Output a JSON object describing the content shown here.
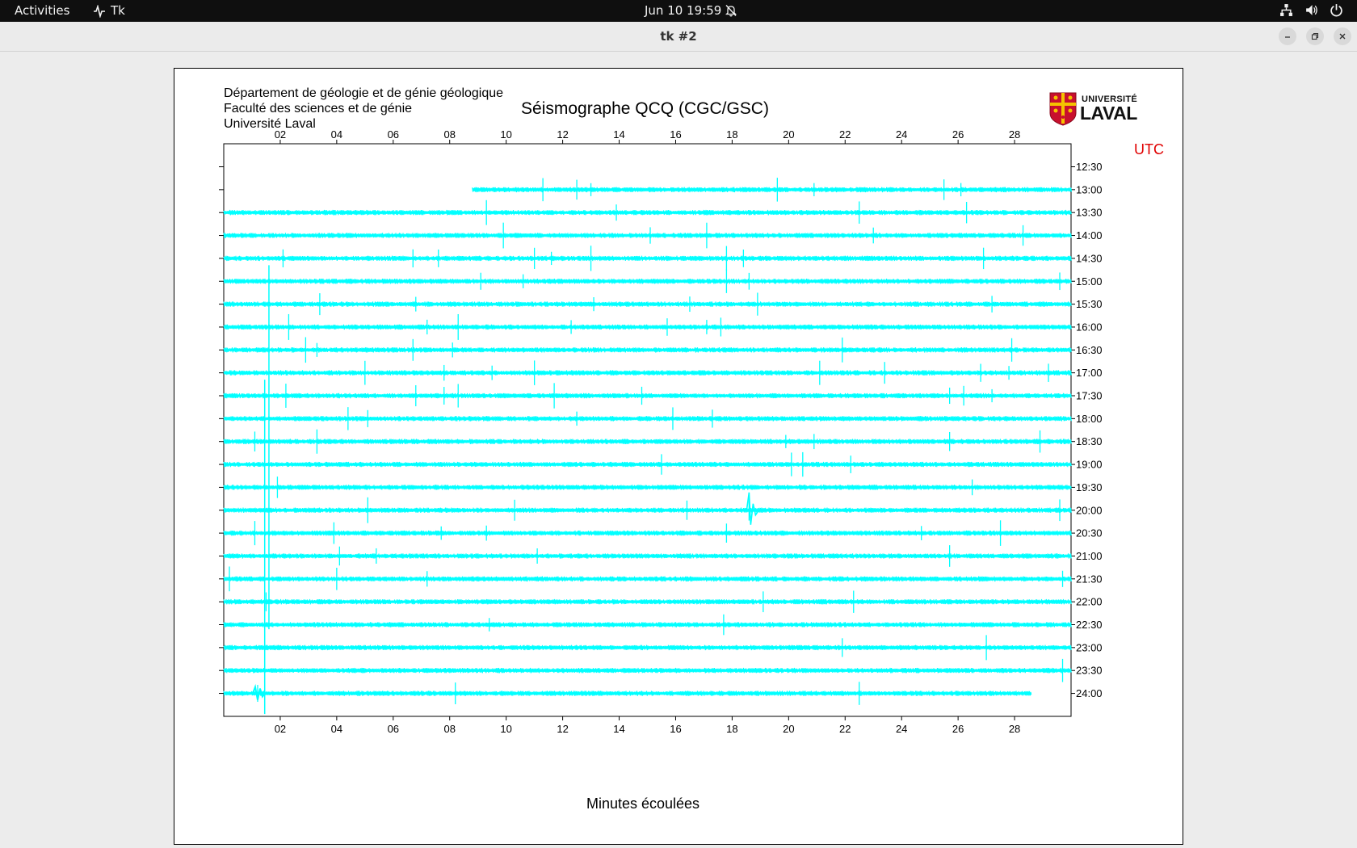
{
  "topbar": {
    "activities": "Activities",
    "app_name": "Tk",
    "clock": "Jun 10  19:59"
  },
  "window": {
    "title": "tk #2"
  },
  "seismogram": {
    "department_lines": [
      "Département de géologie et de génie géologique",
      "Faculté des sciences et de génie",
      "Université Laval"
    ],
    "title": "Séismographe QCQ (CGC/GSC)",
    "utc_label": "UTC",
    "xlabel": "Minutes écoulées",
    "logo_line1": "UNIVERSITÉ",
    "logo_line2": "LAVAL"
  },
  "chart_data": {
    "type": "line",
    "trace_color": "#00ffff",
    "x_unit": "minutes",
    "x_range": [
      0,
      30
    ],
    "x_ticks": [
      "02",
      "04",
      "06",
      "08",
      "10",
      "12",
      "14",
      "16",
      "18",
      "20",
      "22",
      "24",
      "26",
      "28"
    ],
    "y_ticks": [
      "12:30",
      "13:00",
      "13:30",
      "14:00",
      "14:30",
      "15:00",
      "15:30",
      "16:00",
      "16:30",
      "17:00",
      "17:30",
      "18:00",
      "18:30",
      "19:00",
      "19:30",
      "20:00",
      "20:30",
      "21:00",
      "21:30",
      "22:00",
      "22:30",
      "23:00",
      "23:30",
      "24:00"
    ],
    "traces": [
      {
        "label": "13:00",
        "start_min": 8.8,
        "end_min": 30,
        "spikes_min": [
          11.3,
          12.5,
          13.0,
          19.6,
          20.9,
          25.5,
          26.1
        ]
      },
      {
        "label": "13:30",
        "start_min": 0,
        "end_min": 30,
        "spikes_min": [
          9.3,
          13.9,
          22.5,
          26.3
        ]
      },
      {
        "label": "14:00",
        "start_min": 0,
        "end_min": 30,
        "spikes_min": [
          9.9,
          15.1,
          17.1,
          23.0,
          28.3
        ]
      },
      {
        "label": "14:30",
        "start_min": 0,
        "end_min": 30,
        "spikes_min": [
          2.1,
          6.7,
          7.6,
          11.0,
          11.6,
          13.0,
          17.8,
          18.4,
          26.9
        ]
      },
      {
        "label": "15:00",
        "start_min": 0,
        "end_min": 30,
        "spikes_min": [
          9.1,
          10.6,
          17.8,
          18.6,
          29.6
        ]
      },
      {
        "label": "15:30",
        "start_min": 0,
        "end_min": 30,
        "spikes_min": [
          3.4,
          6.8,
          13.1,
          16.5,
          18.9,
          27.2
        ]
      },
      {
        "label": "16:00",
        "start_min": 0,
        "end_min": 30,
        "spikes_min": [
          2.3,
          7.2,
          8.3,
          12.3,
          15.7,
          17.1,
          17.6
        ]
      },
      {
        "label": "16:30",
        "start_min": 0,
        "end_min": 30,
        "spikes_min": [
          2.9,
          3.3,
          6.7,
          8.1,
          21.9,
          27.9
        ]
      },
      {
        "label": "17:00",
        "start_min": 0,
        "end_min": 30,
        "spikes_min": [
          5.0,
          7.8,
          9.5,
          11.0,
          21.1,
          23.4,
          26.8,
          27.8,
          29.2
        ]
      },
      {
        "label": "17:30",
        "start_min": 0,
        "end_min": 30,
        "spikes_min": [
          2.2,
          6.8,
          7.8,
          8.3,
          11.7,
          14.8,
          25.7,
          26.2,
          27.2
        ]
      },
      {
        "label": "18:00",
        "start_min": 0,
        "end_min": 30,
        "spikes_min": [
          4.4,
          5.1,
          12.5,
          15.9,
          17.3
        ]
      },
      {
        "label": "18:30",
        "start_min": 0,
        "end_min": 30,
        "spikes_min": [
          1.1,
          3.3,
          19.9,
          20.9,
          25.7,
          28.9
        ]
      },
      {
        "label": "19:00",
        "start_min": 0,
        "end_min": 30,
        "spikes_min": [
          15.5,
          20.1,
          20.5,
          22.2
        ]
      },
      {
        "label": "19:30",
        "start_min": 0,
        "end_min": 30,
        "spikes_min": [
          1.9,
          26.5
        ]
      },
      {
        "label": "20:00",
        "start_min": 0,
        "end_min": 30,
        "spikes_min": [
          5.1,
          10.3,
          16.4,
          18.6,
          29.6
        ]
      },
      {
        "label": "20:30",
        "start_min": 0,
        "end_min": 30,
        "spikes_min": [
          1.1,
          3.9,
          7.7,
          9.3,
          17.8,
          24.7,
          27.5
        ]
      },
      {
        "label": "21:00",
        "start_min": 0,
        "end_min": 30,
        "spikes_min": [
          4.1,
          5.4,
          11.1,
          25.7
        ]
      },
      {
        "label": "21:30",
        "start_min": 0,
        "end_min": 30,
        "spikes_min": [
          0.2,
          4.0,
          7.2,
          29.7
        ]
      },
      {
        "label": "22:00",
        "start_min": 0,
        "end_min": 30,
        "spikes_min": [
          1.5,
          19.1,
          22.3
        ]
      },
      {
        "label": "22:30",
        "start_min": 0,
        "end_min": 30,
        "spikes_min": [
          9.4,
          17.7
        ]
      },
      {
        "label": "23:00",
        "start_min": 0,
        "end_min": 30,
        "spikes_min": [
          21.9,
          27.0
        ]
      },
      {
        "label": "23:30",
        "start_min": 0,
        "end_min": 30,
        "spikes_min": [
          29.7
        ]
      },
      {
        "label": "24:00",
        "start_min": 0,
        "end_min": 28.6,
        "spikes_min": [
          1.2,
          8.2,
          22.5
        ]
      }
    ],
    "grid": false
  }
}
